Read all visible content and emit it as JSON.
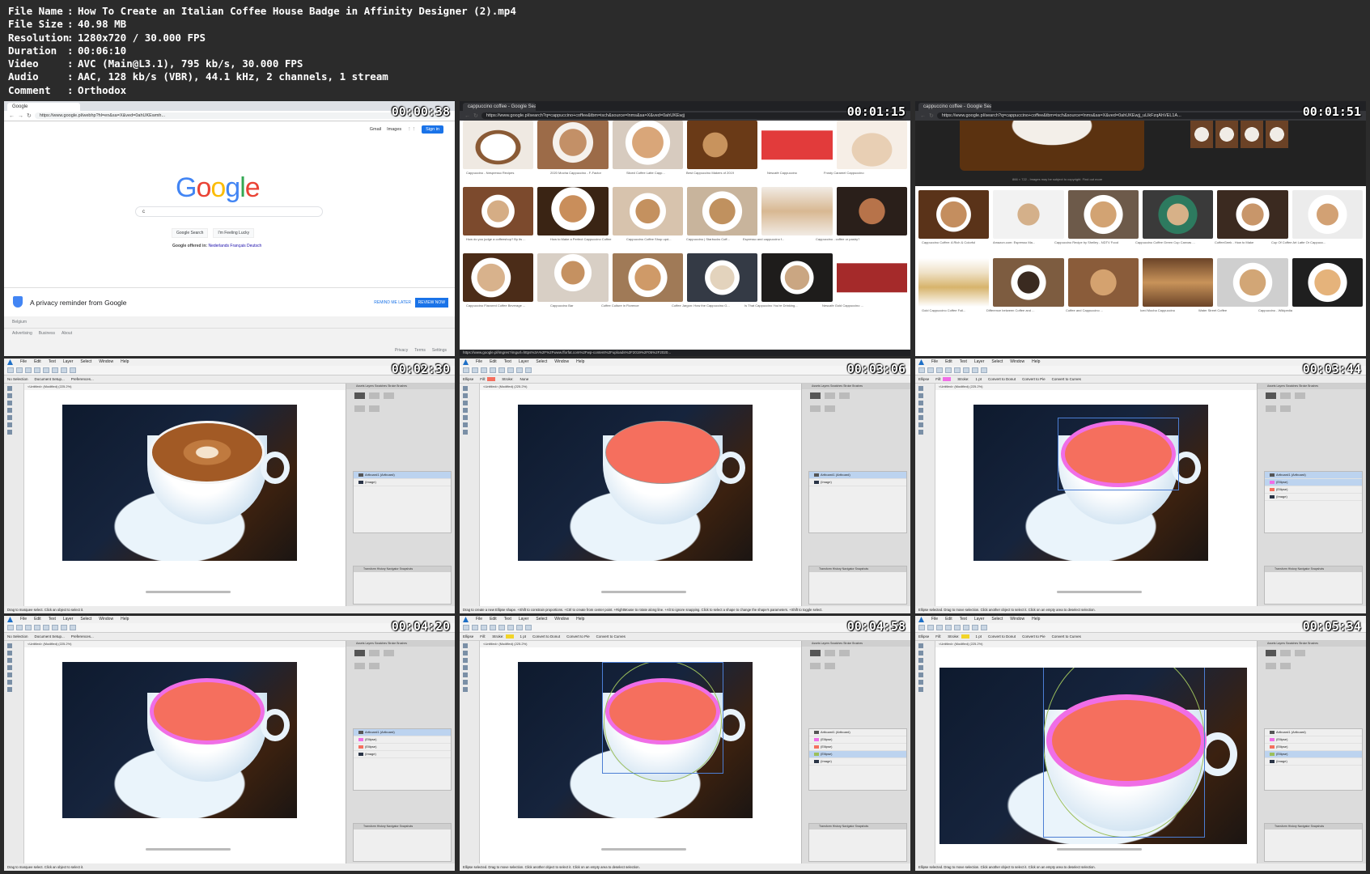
{
  "info": [
    {
      "key": "File Name",
      "value": "How To Create an Italian Coffee House Badge in Affinity Designer (2).mp4"
    },
    {
      "key": "File Size",
      "value": "40.98 MB"
    },
    {
      "key": "Resolution",
      "value": "1280x720 / 30.000 FPS"
    },
    {
      "key": "Duration",
      "value": "00:06:10"
    },
    {
      "key": "Video",
      "value": "AVC (Main@L3.1), 795 kb/s, 30.000 FPS"
    },
    {
      "key": "Audio",
      "value": "AAC, 128 kb/s (VBR), 44.1 kHz, 2 channels, 1 stream"
    },
    {
      "key": "Comment",
      "value": "Orthodox"
    }
  ],
  "timestamps": [
    "00:00:38",
    "00:01:15",
    "00:01:51",
    "00:02:30",
    "00:03:06",
    "00:03:44",
    "00:04:20",
    "00:04:58",
    "00:05:34"
  ],
  "google": {
    "tab": "Google",
    "url": "https://www.google.pl/webhp?hl=en&sa=X&ved=0ahUKEwmh...",
    "top_links": [
      "Gmail",
      "Images"
    ],
    "signin": "Sign in",
    "logo": [
      "G",
      "o",
      "o",
      "g",
      "l",
      "e"
    ],
    "search_value": "c",
    "btn_search": "Google Search",
    "btn_lucky": "I'm Feeling Lucky",
    "offered_prefix": "Google offered in:",
    "offered_langs": "Nederlands  Français  Deutsch",
    "privacy_text": "A privacy reminder from Google",
    "remind_later": "REMIND ME LATER",
    "review_now": "REVIEW NOW",
    "country": "Belgium",
    "footer_left": [
      "Advertising",
      "Business",
      "About"
    ],
    "footer_right": [
      "Privacy",
      "Terms",
      "Settings"
    ]
  },
  "image_search": {
    "tab": "cappuccino coffee - Google Sea",
    "url": "https://www.google.pl/search?q=cappuccino+coffee&tbm=isch&source=lnms&sa=X&ved=0ahUKEwjj",
    "captions_row1": [
      "Cappuccino - Nespresso Recipes",
      "2020 Mocha Cappuccino - F-Factor",
      "Sliced Coffee Latte Capp...",
      "Best Cappuccino Makers of 2019",
      "Nescafé Cappuccino",
      "Frosty Caramel Cappuccino"
    ],
    "captions_row2": [
      "How do you judge a coffeeshop? By its ...",
      "How to Make a Perfect Cappuccino Coffee",
      "Cappuccino Coffee Shop upd...",
      "Cappuccino | Starbucks Coff...",
      "Espresso and cappuccino f...",
      "Cappuccino - coffee or pastry?"
    ],
    "captions_row3": [
      "Cappuccino Flavored Coffee Beverage ...",
      "Cappuccino Bar",
      "Coffee Culture in Florence",
      "Coffee Jargon: How the Cappuccino G...",
      "Is That Cappuccino You're Drinking...",
      "Nescafe Gold Cappuccino ..."
    ],
    "status_url": "https://www.google.pl/imgres?imgurl=https%3A%2F%2Fwww.fforfat.com%2Fwp-content%2Fuploads%2F2019%2F05%2F2020..."
  },
  "image_preview": {
    "tab": "cappuccino coffee - Google Sea",
    "url": "https://www.google.pl/search?q=cappuccino+coffee&tbm=isch&source=lnms&sa=X&ved=0ahUKEwjj_uLlkFzqAhVEL1A...",
    "caption": "866 × 722 - Images may be subject to copyright. Find out more",
    "captions_row1": [
      "Cappuccino Coffee: A Rich & Colorful",
      "Amazon.com: Espresso Ma...",
      "Cappuccino Recipe by Shelley - NDTV Food",
      "Cappuccino Coffee Green Cup Canvas ...",
      "CoffeeGeek - How to Make",
      "Cup Of Coffee Art Latte Or Cappucc..."
    ],
    "captions_row2": [
      "Gold Cappuccino Coffee Foil...",
      "Difference between Coffee and ...",
      "Coffee and Cappuccino ...",
      "Iced Mocha Cappuccino",
      "Water Street Coffee",
      "Cappuccino - Wikipedia"
    ]
  },
  "affinity": {
    "menu": [
      "File",
      "Edit",
      "Text",
      "Layer",
      "Select",
      "Window",
      "Help"
    ],
    "doc_title": "<Untitled> (Modified) (225.2%)",
    "ctx_noselect": [
      "No Selection",
      "Document Setup...",
      "Preferences..."
    ],
    "ctx_ellipse": [
      "Ellipse",
      "Fill:",
      "Stroke:",
      "None"
    ],
    "ctx_ellipse2": [
      "Ellipse",
      "Fill:",
      "Stroke:",
      "1 pt",
      "Convert to Donut",
      "Convert to Pie",
      "Convert to Curves"
    ],
    "tabs": "Assets  Layers  Swatches  Stroke  Brushes",
    "layers_1": [
      "Artboard1 (Artboard)",
      "(Image)"
    ],
    "layers_3": [
      "Artboard1 (Artboard)",
      "(Ellipse)",
      "(Ellipse)",
      "(Image)"
    ],
    "layers_4": [
      "Artboard1 (Artboard)",
      "(Ellipse)",
      "(Ellipse)",
      "(Ellipse)",
      "(Image)"
    ],
    "transform_tab": "Transform  History  Navigator  Snapshots",
    "status_drag": "Drag to marquee select. Click an object to select it.",
    "status_ellipse": "Drag to create a new Ellipse shape. +Shift to constrain proportions. +Ctrl to create from center point. +RightMouse to rotate along line. +Alt to ignore snapping. Click to select a shape to change the shape's parameters. +Shift to toggle select.",
    "status_selected": "Ellipse selected. Drag to move selection. Click another object to select it. Click on an empty area to deselect selection.",
    "colors": {
      "ellipse_fill": "#f56f5e",
      "ellipse_stroke": "#f06ee6",
      "accent": "#1d6fc6"
    }
  }
}
